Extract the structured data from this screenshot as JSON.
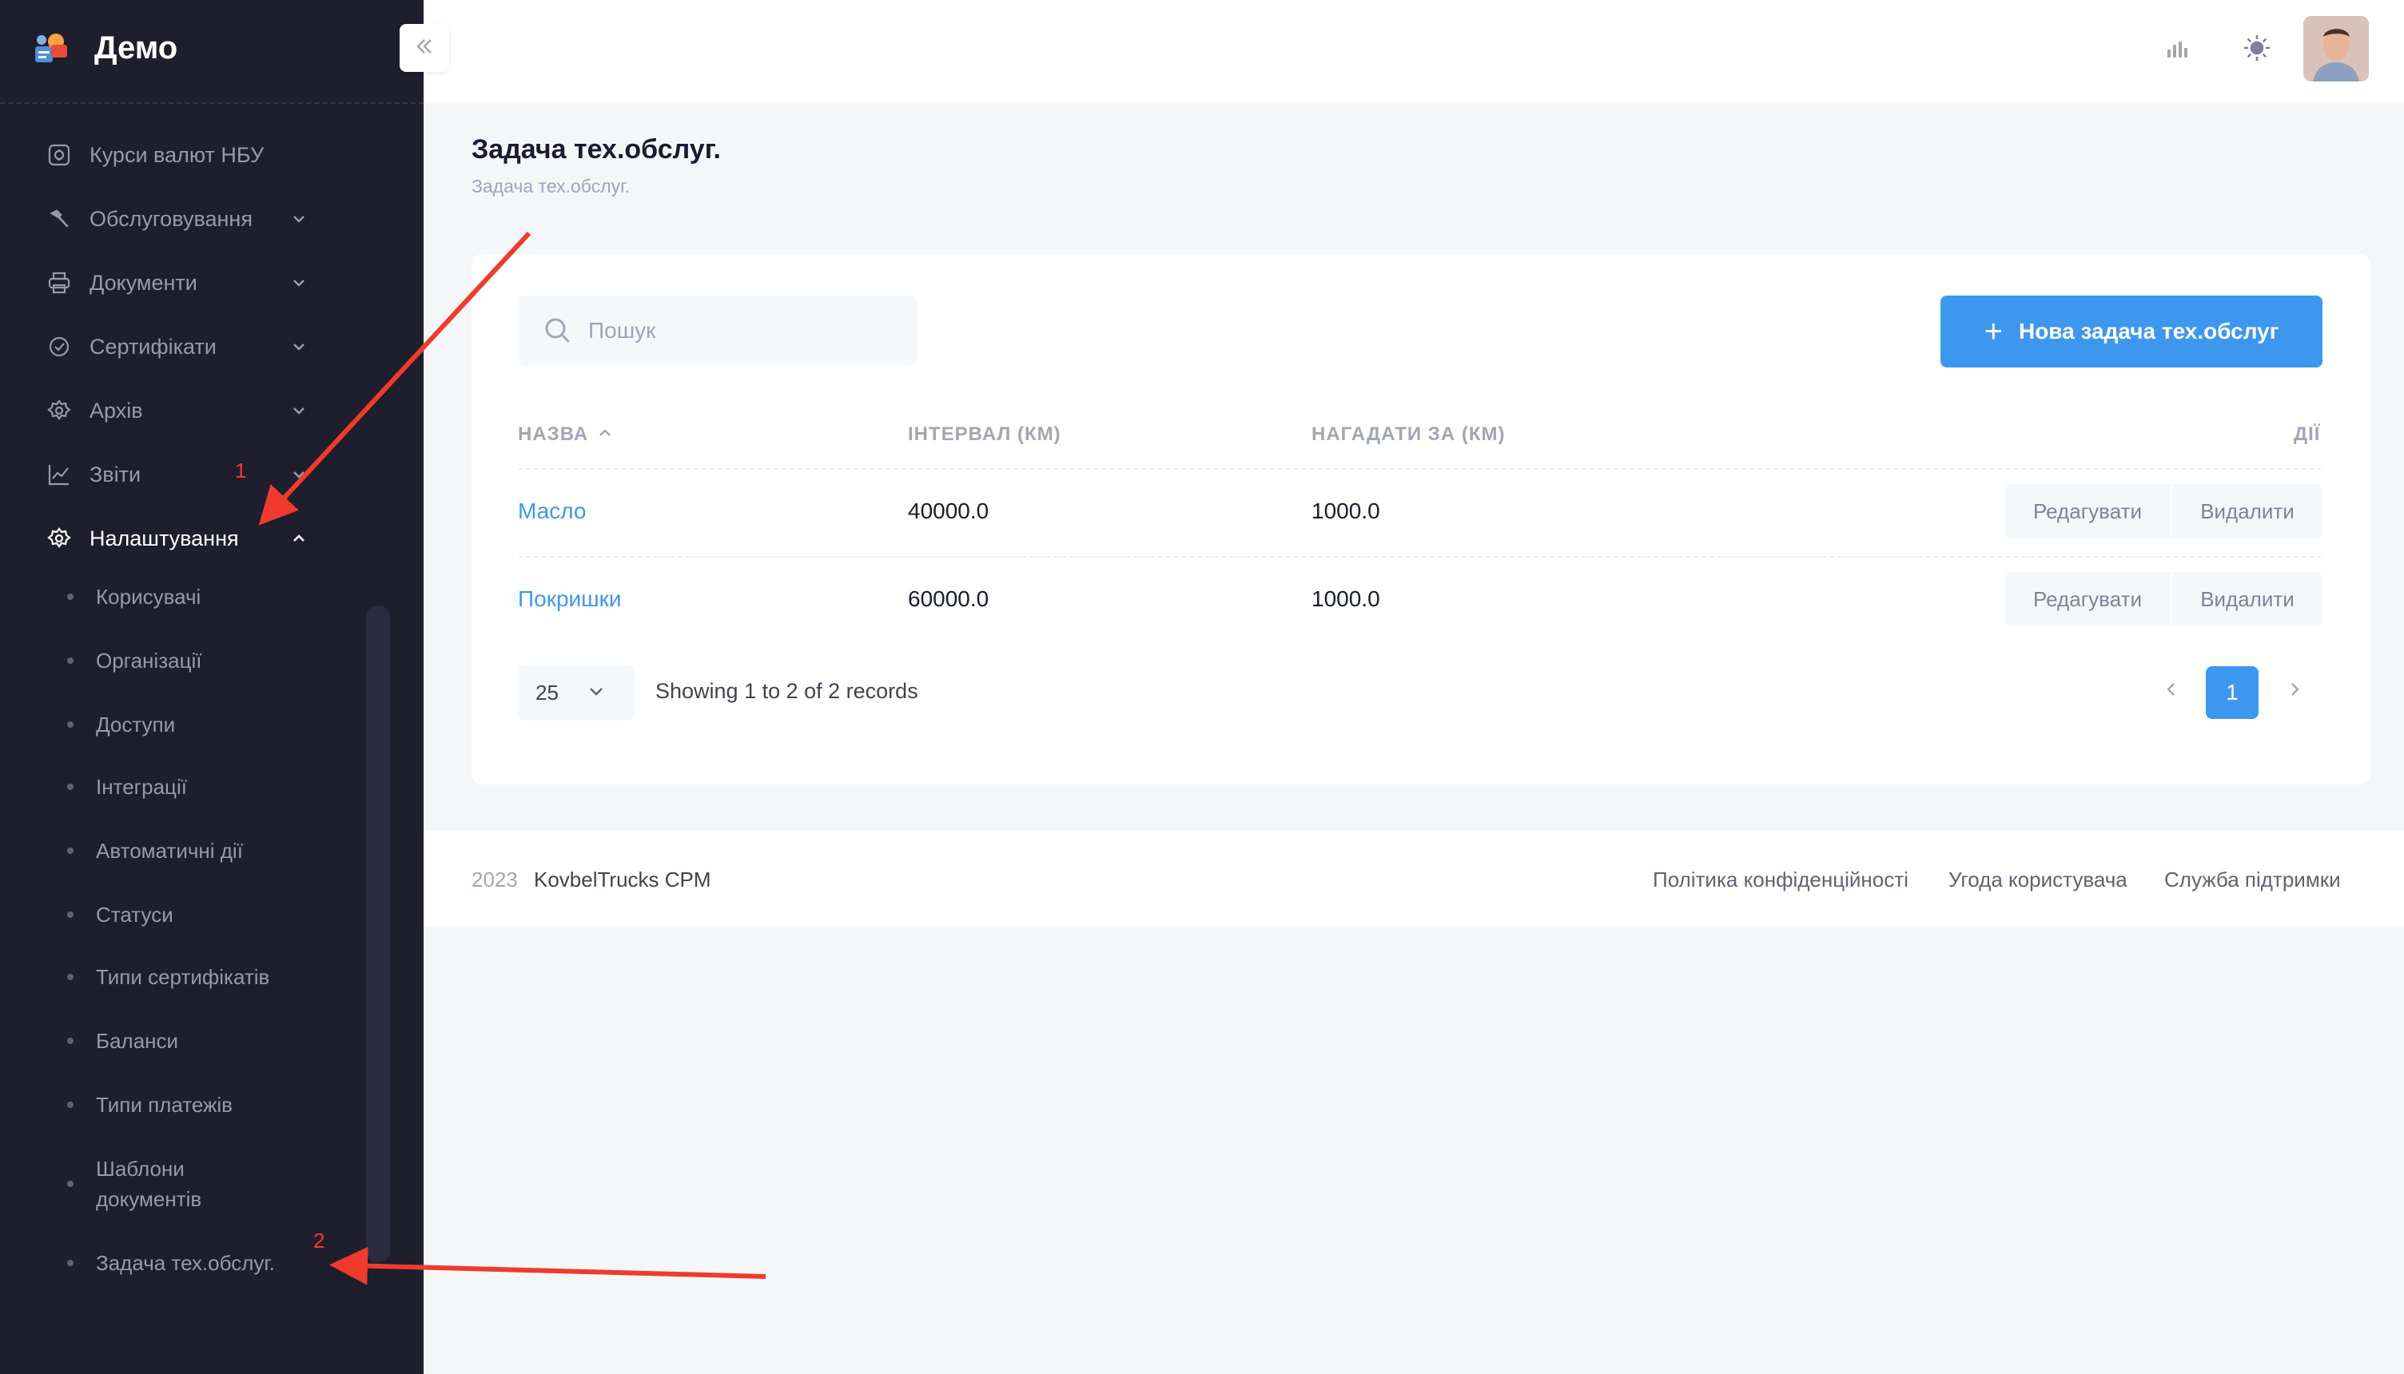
{
  "app": {
    "brand_title": "Демо"
  },
  "sidebar": {
    "items": [
      {
        "label": "Курси валют НБУ",
        "icon": "currency-icon",
        "has_chevron": false
      },
      {
        "label": "Обслуговування",
        "icon": "hammer-icon",
        "has_chevron": true
      },
      {
        "label": "Документи",
        "icon": "printer-icon",
        "has_chevron": true
      },
      {
        "label": "Сертифікати",
        "icon": "check-circle-icon",
        "has_chevron": true
      },
      {
        "label": "Архів",
        "icon": "gear-icon",
        "has_chevron": true
      },
      {
        "label": "Звіти",
        "icon": "chart-line-icon",
        "has_chevron": true
      },
      {
        "label": "Налаштування",
        "icon": "gear-icon",
        "has_chevron": true,
        "expanded": true
      }
    ],
    "sub_items": [
      "Корисувачі",
      "Організації",
      "Доступи",
      "Інтеграції",
      "Автоматичні дії",
      "Статуси",
      "Типи сертифікатів",
      "Баланси",
      "Типи платежів",
      "Шаблони документів",
      "Задача тех.обслуг."
    ]
  },
  "annotations": {
    "label_1": "1",
    "label_2": "2",
    "color": "#f03a2e"
  },
  "page": {
    "title": "Задача тех.обслуг.",
    "breadcrumb": "Задача тех.обслуг."
  },
  "toolbar": {
    "search_placeholder": "Пошук",
    "new_button_label": "Нова задача тех.обслуг"
  },
  "table": {
    "columns": [
      "НАЗВА",
      "ІНТЕРВАЛ (КМ)",
      "НАГАДАТИ ЗА (КМ)",
      "ДІЇ"
    ],
    "rows": [
      {
        "name": "Масло",
        "interval": "40000.0",
        "remind": "1000.0",
        "edit": "Редагувати",
        "delete": "Видалити"
      },
      {
        "name": "Покришки",
        "interval": "60000.0",
        "remind": "1000.0",
        "edit": "Редагувати",
        "delete": "Видалити"
      }
    ]
  },
  "pagination": {
    "page_size": "25",
    "info": "Showing 1 to 2 of 2 records",
    "current_page": "1"
  },
  "footer": {
    "year": "2023",
    "brand": "KovbelTrucks CPM",
    "links": [
      "Політика конфіденційності",
      "Угода користувача",
      "Служба підтримки"
    ]
  },
  "colors": {
    "sidebar_bg": "#1e1e2d",
    "primary": "#3e97ef",
    "annotation": "#f03a2e"
  }
}
